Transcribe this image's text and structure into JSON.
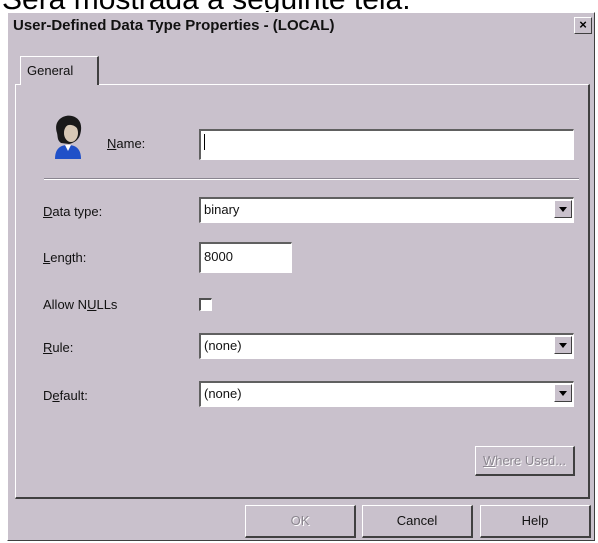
{
  "caption": "Será mostrada a seguinte tela:",
  "window": {
    "title": "User-Defined Data Type Properties - (LOCAL)",
    "close_glyph": "×"
  },
  "tabs": [
    {
      "label": "General",
      "selected": true
    }
  ],
  "form": {
    "name": {
      "label_pre": "",
      "label_acc": "N",
      "label_post": "ame:",
      "value": ""
    },
    "data_type": {
      "label_pre": "",
      "label_acc": "D",
      "label_post": "ata type:",
      "value": "binary"
    },
    "length": {
      "label_pre": "",
      "label_acc": "L",
      "label_post": "ength:",
      "value": "8000"
    },
    "allow_nulls": {
      "label_pre": "Allow N",
      "label_acc": "U",
      "label_post": "LLs",
      "checked": false
    },
    "rule": {
      "label_pre": "",
      "label_acc": "R",
      "label_post": "ule:",
      "value": "(none)"
    },
    "default": {
      "label_pre": "D",
      "label_acc": "e",
      "label_post": "fault:",
      "value": "(none)"
    }
  },
  "where_used": {
    "label_pre": "",
    "label_acc": "W",
    "label_post": "here Used...",
    "enabled": false
  },
  "footer": {
    "ok_label": "OK",
    "cancel_label": "Cancel",
    "help_label": "Help"
  },
  "icons": {
    "user_icon": "user-avatar-icon",
    "dropdown_icon": "chevron-down-icon"
  }
}
